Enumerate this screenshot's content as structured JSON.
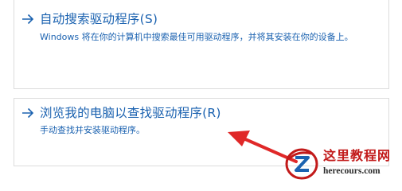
{
  "options": [
    {
      "title": "自动搜索驱动程序(S)",
      "description": "Windows 将在你的计算机中搜索最佳可用驱动程序，并将其安装在你的设备上。"
    },
    {
      "title": "浏览我的电脑以查找驱动程序(R)",
      "description": "手动查找并安装驱动程序。"
    }
  ],
  "colors": {
    "link_blue": "#1b62b0",
    "annotation_red": "#e02828",
    "border_gray": "#dcdcdc",
    "watermark_red": "#c21a1a"
  },
  "icons": {
    "option_arrow": "right-arrow-icon",
    "annotation": "red-pointer-arrow",
    "watermark_logo": "z-logo-icon"
  },
  "watermark": {
    "title": "这里教程网",
    "url": "herecours.com"
  }
}
